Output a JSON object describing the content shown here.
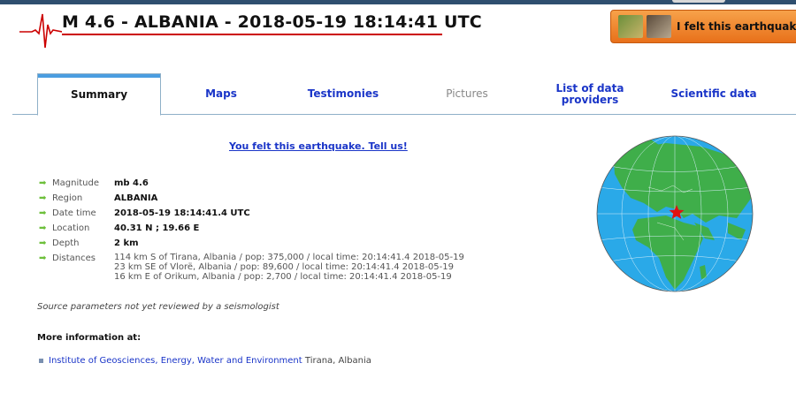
{
  "header": {
    "title": "M 4.6 - ALBANIA - 2018-05-19 18:14:41 UTC",
    "felt_button": "I felt this earthquake"
  },
  "tabs": [
    {
      "label": "Summary",
      "active": true
    },
    {
      "label": "Maps",
      "active": false
    },
    {
      "label": "Testimonies",
      "active": false
    },
    {
      "label": "Pictures",
      "active": false,
      "disabled": true
    },
    {
      "label": "List of data providers",
      "active": false
    },
    {
      "label": "Scientific data",
      "active": false
    }
  ],
  "tell_us_link": "You felt this earthquake. Tell us!",
  "details": {
    "magnitude": {
      "label": "Magnitude",
      "value": "mb 4.6"
    },
    "region": {
      "label": "Region",
      "value": "ALBANIA"
    },
    "date_time": {
      "label": "Date time",
      "value": "2018-05-19 18:14:41.4 UTC"
    },
    "location": {
      "label": "Location",
      "value": "40.31 N ; 19.66 E"
    },
    "depth": {
      "label": "Depth",
      "value": "2 km"
    },
    "distances": {
      "label": "Distances",
      "lines": [
        "114 km S of Tirana, Albania / pop: 375,000 / local time: 20:14:41.4 2018-05-19",
        "23 km SE of Vlorë, Albania / pop: 89,600 / local time: 20:14:41.4 2018-05-19",
        "16 km E of Orikum, Albania / pop: 2,700 / local time: 20:14:41.4 2018-05-19"
      ]
    }
  },
  "source_note": "Source parameters not yet reviewed by a seismologist",
  "more_info": {
    "heading": "More information at:",
    "link": "Institute of Geosciences, Energy, Water and Environment",
    "city": "Tirana, Albania"
  },
  "colors": {
    "accent": "#1a35c8",
    "title_underline": "#cc0000",
    "button_orange": "#f08a30",
    "arrow_green": "#6cbf3a",
    "ocean": "#2aa9e8",
    "land": "#3fae4a",
    "epicenter_star": "#e01010"
  },
  "icons": {
    "logo": "seismogram-icon",
    "row_marker": "arrow-right-icon",
    "epicenter": "star-icon"
  }
}
